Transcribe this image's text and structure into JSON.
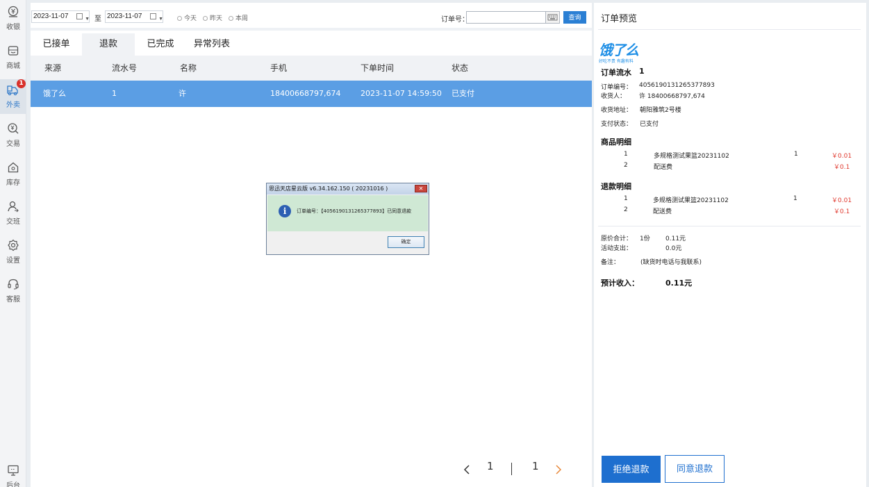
{
  "sidebar": {
    "items": [
      {
        "label": "收银",
        "icon": "cashier-icon"
      },
      {
        "label": "商城",
        "icon": "store-icon"
      },
      {
        "label": "外卖",
        "icon": "delivery-icon",
        "badge": "1"
      },
      {
        "label": "交易",
        "icon": "transaction-icon"
      },
      {
        "label": "库存",
        "icon": "inventory-icon"
      },
      {
        "label": "交班",
        "icon": "shift-icon"
      },
      {
        "label": "设置",
        "icon": "settings-icon"
      },
      {
        "label": "客服",
        "icon": "support-icon"
      },
      {
        "label": "后台",
        "icon": "backend-icon"
      }
    ]
  },
  "toolbar": {
    "date_from": "2023-11-07",
    "to_label": "至",
    "date_to": "2023-11-07",
    "quick_dates": [
      "今天",
      "昨天",
      "本周"
    ],
    "order_no_label": "订单号：",
    "order_no_value": "",
    "query_label": "查询"
  },
  "tabs": [
    "已接单",
    "退款",
    "已完成",
    "异常列表"
  ],
  "table": {
    "columns": [
      "来源",
      "流水号",
      "名称",
      "手机",
      "下单时间",
      "状态"
    ],
    "rows": [
      [
        "饿了么",
        "1",
        "许",
        "18400668797,674",
        "2023-11-07 14:59:50",
        "已支付"
      ]
    ]
  },
  "pager": {
    "current": "1",
    "total": "1"
  },
  "dialog": {
    "title": "思迅天店星云版 v6.34.162.150 ( 20231016 )",
    "close": "✕",
    "message": "订单编号：【4056190131265377893】已同意退款",
    "ok_label": "确定"
  },
  "preview": {
    "title": "订单预览",
    "logo_text": "饿了么",
    "logo_slogan": "好吃不贵 有趣有料",
    "serial_label": "订单流水",
    "serial_value": "1",
    "order_no_label": "订单编号：",
    "order_no_value": "4056190131265377893",
    "receiver_label": "收货人：",
    "receiver_value": "许 18400668797,674",
    "address_label": "收货地址：",
    "address_value": "朝阳雅筑2号楼",
    "pay_status_label": "支付状态：",
    "pay_status_value": "已支付",
    "goods_title": "商品明细",
    "goods": [
      {
        "idx": "1",
        "name": "多规格测试果篮20231102",
        "qty": "1",
        "price": "￥0.01"
      },
      {
        "idx": "2",
        "name": "配送费",
        "qty": "",
        "price": "￥0.1"
      }
    ],
    "refund_title": "退款明细",
    "refunds": [
      {
        "idx": "1",
        "name": "多规格测试果篮20231102",
        "qty": "1",
        "price": "￥0.01"
      },
      {
        "idx": "2",
        "name": "配送费",
        "qty": "",
        "price": "￥0.1"
      }
    ],
    "original_total_label": "原价合计：",
    "original_total_qty": "1份",
    "original_total_value": "0.11元",
    "activity_label": "活动支出：",
    "activity_value": "0.0元",
    "remark_label": "备注：",
    "remark_value": "(缺货时电话与我联系)",
    "income_label": "预计收入：",
    "income_value": "0.11元",
    "reject_label": "拒绝退款",
    "agree_label": "同意退款"
  }
}
